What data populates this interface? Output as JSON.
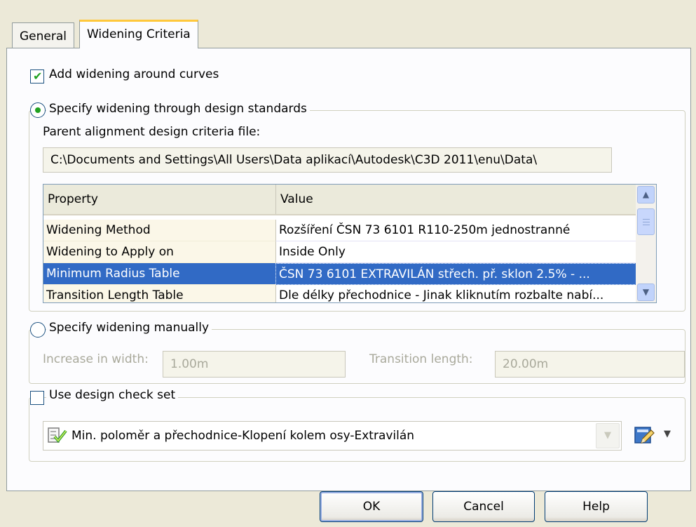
{
  "tabs": [
    {
      "label": "General",
      "active": false
    },
    {
      "label": "Widening Criteria",
      "active": true
    }
  ],
  "add_widening": {
    "label": "Add widening around curves",
    "checked": true
  },
  "standards": {
    "label": "Specify widening through design standards",
    "selected": true,
    "file_label": "Parent alignment design criteria file:",
    "file_path": "C:\\Documents and Settings\\All Users\\Data aplikací\\Autodesk\\C3D 2011\\enu\\Data\\"
  },
  "grid": {
    "headers": [
      "Property",
      "Value"
    ],
    "rows": [
      {
        "property": "Widening Method",
        "value": "Rozšíření ČSN 73 6101 R110-250m jednostranné",
        "selected": false
      },
      {
        "property": "Widening to Apply on",
        "value": "Inside Only",
        "selected": false
      },
      {
        "property": "Minimum Radius Table",
        "value": "ČSN 73 6101 EXTRAVILÁN střech. př. sklon 2.5% - ...",
        "selected": true
      },
      {
        "property": "Transition Length Table",
        "value": "Dle délky přechodnice - Jinak kliknutím rozbalte nabí...",
        "selected": false
      }
    ]
  },
  "manual": {
    "label": "Specify widening manually",
    "selected": false,
    "increase_label": "Increase in width:",
    "increase_value": "1.00m",
    "transition_label": "Transition length:",
    "transition_value": "20.00m"
  },
  "check_set": {
    "label": "Use design check set",
    "checked": false,
    "value": "Min. poloměr a přechodnice-Klopení kolem osy-Extravilán"
  },
  "buttons": {
    "ok": "OK",
    "cancel": "Cancel",
    "help": "Help"
  },
  "colors": {
    "selection": "#316ac5",
    "tab_accent": "#ffc83c",
    "check_green": "#21a121",
    "dialog_bg": "#ece9d8"
  }
}
